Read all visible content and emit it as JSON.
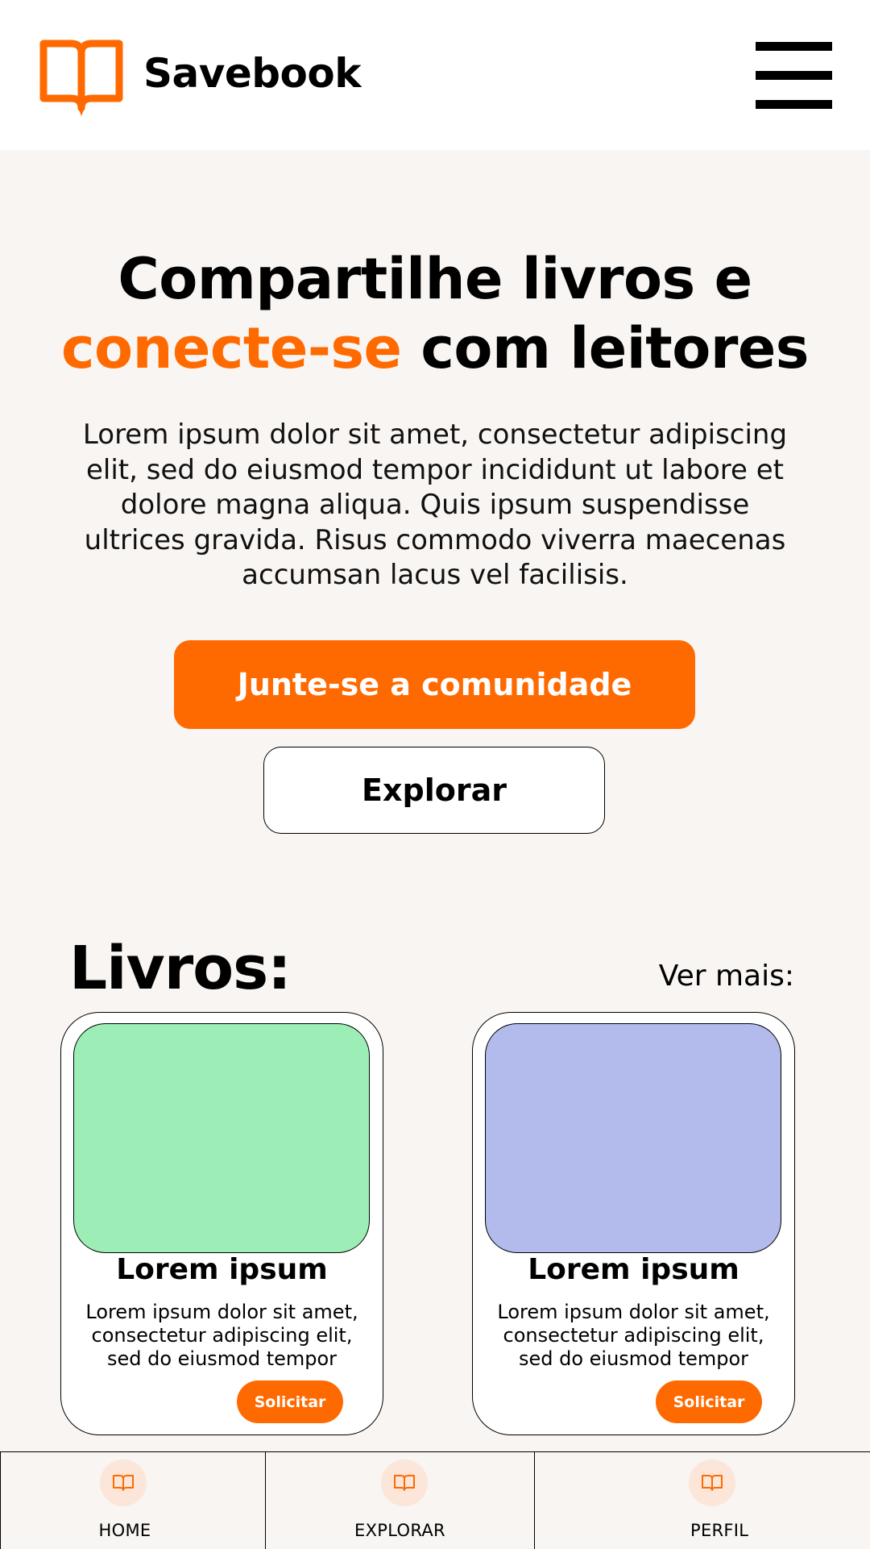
{
  "header": {
    "brand": "Savebook",
    "logo_icon": "open-book-icon",
    "menu_icon": "hamburger-menu-icon"
  },
  "hero": {
    "title_line1": "Compartilhe livros e",
    "title_accent": "conecte-se",
    "title_rest": " com leitores",
    "description": "Lorem ipsum dolor sit amet, consectetur adipiscing elit, sed do eiusmod tempor incididunt ut labore et dolore magna aliqua. Quis ipsum suspendisse ultrices gravida. Risus commodo viverra maecenas accumsan lacus vel facilisis.",
    "primary_button": "Junte-se a comunidade",
    "secondary_button": "Explorar"
  },
  "books": {
    "title": "Livros:",
    "see_more": "Ver mais:",
    "items": [
      {
        "title": "Lorem ipsum",
        "description": "Lorem ipsum dolor sit amet, consectetur adipiscing elit, sed do eiusmod tempor incididunt ut labore",
        "button": "Solicitar",
        "image_color": "#9deeb6"
      },
      {
        "title": "Lorem ipsum",
        "description": "Lorem ipsum dolor sit amet, consectetur adipiscing elit, sed do eiusmod tempor incididunt ut labore",
        "button": "Solicitar",
        "image_color": "#b3bbec"
      }
    ]
  },
  "bottom_nav": {
    "items": [
      {
        "label": "HOME",
        "icon": "book-icon"
      },
      {
        "label": "EXPLORAR",
        "icon": "book-icon"
      },
      {
        "label": "PERFIL",
        "icon": "book-icon"
      }
    ]
  },
  "colors": {
    "accent": "#ff6a00",
    "background": "#f8f5f2",
    "nav_icon_bg": "#fbe6d9"
  }
}
